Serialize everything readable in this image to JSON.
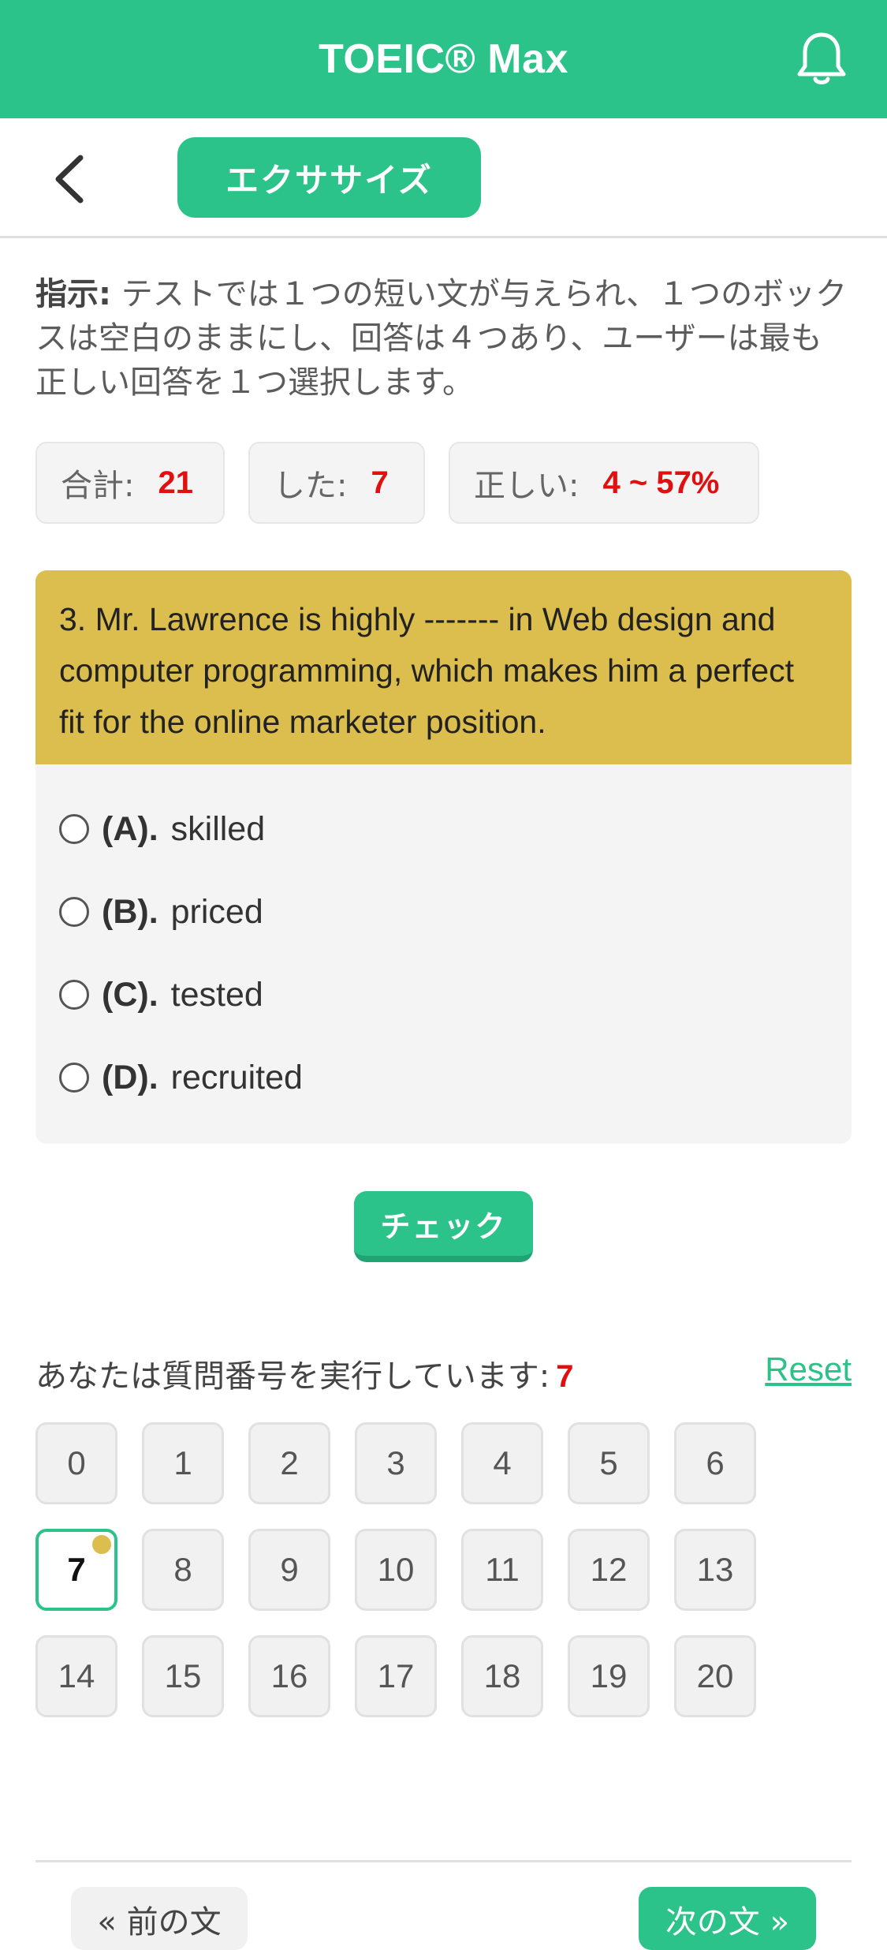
{
  "app": {
    "title": "TOEIC® Max"
  },
  "subheader": {
    "exercise_label": "エクササイズ"
  },
  "instructions": {
    "label": "指示:",
    "text": " テストでは１つの短い文が与えられ、１つのボックスは空白のままにし、回答は４つあり、ユーザーは最も正しい回答を１つ選択します。"
  },
  "stats": {
    "total_label": "合計:",
    "total_value": "21",
    "done_label": "した:",
    "done_value": "7",
    "correct_label": "正しい:",
    "correct_value": "4 ~ 57%"
  },
  "question": {
    "text": "3. Mr. Lawrence is highly ------- in Web design and computer programming, which makes him a perfect fit for the online marketer position.",
    "options": [
      {
        "letter": "(A).",
        "text": "skilled"
      },
      {
        "letter": "(B).",
        "text": "priced"
      },
      {
        "letter": "(C).",
        "text": "tested"
      },
      {
        "letter": "(D).",
        "text": "recruited"
      }
    ]
  },
  "check_label": "チェック",
  "progress": {
    "running_label": "あなたは質問番号を実行しています:",
    "current": "7",
    "reset_label": "Reset"
  },
  "grid": [
    "0",
    "1",
    "2",
    "3",
    "4",
    "5",
    "6",
    "7",
    "8",
    "9",
    "10",
    "11",
    "12",
    "13",
    "14",
    "15",
    "16",
    "17",
    "18",
    "19",
    "20"
  ],
  "nav": {
    "prev_label": "« 前の文",
    "next_label": "次の文 »"
  },
  "colors": {
    "brand": "#2bc38a",
    "question_bg": "#dcbe4f",
    "highlight_red": "#e01010"
  }
}
